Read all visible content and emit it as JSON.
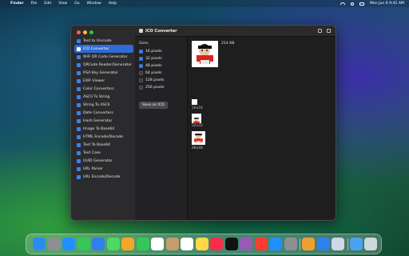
{
  "menubar": {
    "app_name": "Finder",
    "items": [
      "File",
      "Edit",
      "View",
      "Go",
      "Window",
      "Help"
    ],
    "clock": "Mon Jun 6  9:41 AM"
  },
  "window": {
    "title": "ICO Converter",
    "sidebar": {
      "items": [
        {
          "label": "Text to Unicode",
          "icon": "text-icon"
        },
        {
          "label": "ICO Converter",
          "icon": "ico-icon",
          "selected": true
        },
        {
          "label": "WiFi QR Code Generator",
          "icon": "wifi-icon"
        },
        {
          "label": "QRCode Reader/Generator",
          "icon": "qrcode-icon"
        },
        {
          "label": "RSA Key Generator",
          "icon": "key-icon"
        },
        {
          "label": "EXIF Viewer",
          "icon": "photo-icon"
        },
        {
          "label": "Color Converters",
          "icon": "palette-icon"
        },
        {
          "label": "ASCII To String",
          "icon": "ascii-icon"
        },
        {
          "label": "String To ASCII",
          "icon": "string-icon"
        },
        {
          "label": "Date Converters",
          "icon": "calendar-icon"
        },
        {
          "label": "Hash Generator",
          "icon": "hash-icon"
        },
        {
          "label": "Image To Base64",
          "icon": "image-icon"
        },
        {
          "label": "HTML Encode/Decode",
          "icon": "html-icon"
        },
        {
          "label": "Text To Base64",
          "icon": "base64-icon"
        },
        {
          "label": "Text Case",
          "icon": "textcase-icon"
        },
        {
          "label": "UUID Generator",
          "icon": "uuid-icon"
        },
        {
          "label": "URL Parser",
          "icon": "link-icon"
        },
        {
          "label": "URL Encode/Decode",
          "icon": "url-icon"
        }
      ]
    },
    "sizes": {
      "title": "Sizes",
      "options": [
        {
          "label": "16 pixels",
          "checked": true
        },
        {
          "label": "32 pixels",
          "checked": true
        },
        {
          "label": "48 pixels",
          "checked": true
        },
        {
          "label": "64 pixels",
          "checked": false
        },
        {
          "label": "128 pixels",
          "checked": false
        },
        {
          "label": "256 pixels",
          "checked": false
        }
      ],
      "save_label": "Save as ICO"
    },
    "preview": {
      "file_size": "214 KB",
      "thumbs": [
        {
          "label": "16x16"
        },
        {
          "label": "32x32"
        },
        {
          "label": "48x48"
        }
      ]
    }
  },
  "dock": {
    "apps": [
      "Finder",
      "Launchpad",
      "Safari",
      "Messages",
      "Mail",
      "Maps",
      "Photos",
      "FaceTime",
      "Calendar",
      "Contacts",
      "Reminders",
      "Notes",
      "Music",
      "TV",
      "Podcasts",
      "News",
      "App Store",
      "System Settings",
      "Pages",
      "Keynote",
      "Preview",
      "Downloads",
      "Trash"
    ]
  }
}
